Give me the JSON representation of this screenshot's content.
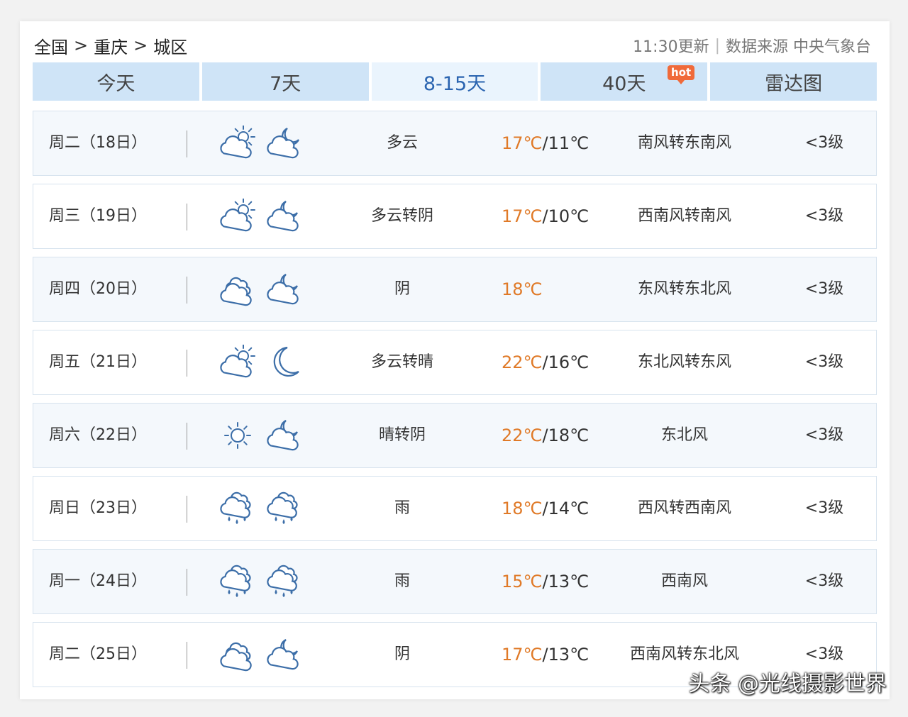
{
  "breadcrumb": {
    "country": "全国",
    "city": "重庆",
    "district": "城区",
    "separator": ">"
  },
  "meta": {
    "update_time": "11:30更新",
    "source": "数据来源 中央气象台"
  },
  "tabs": [
    {
      "label": "今天"
    },
    {
      "label": "7天"
    },
    {
      "label": "8-15天",
      "active": true
    },
    {
      "label": "40天",
      "badge": "hot"
    },
    {
      "label": "雷达图"
    }
  ],
  "forecast": [
    {
      "day": "周二（18日）",
      "icon_day": "partly-cloudy-day-icon",
      "icon_night": "partly-cloudy-night-icon",
      "desc": "多云",
      "high": "17℃",
      "low": "/11℃",
      "wind": "南风转东南风",
      "level": "<3级"
    },
    {
      "day": "周三（19日）",
      "icon_day": "partly-cloudy-day-icon",
      "icon_night": "overcast-night-icon",
      "desc": "多云转阴",
      "high": "17℃",
      "low": "/10℃",
      "wind": "西南风转南风",
      "level": "<3级"
    },
    {
      "day": "周四（20日）",
      "icon_day": "overcast-icon",
      "icon_night": "overcast-night-icon",
      "desc": "阴",
      "high": "18℃",
      "low": "",
      "wind": "东风转东北风",
      "level": "<3级"
    },
    {
      "day": "周五（21日）",
      "icon_day": "partly-cloudy-day-icon",
      "icon_night": "moon-icon",
      "desc": "多云转晴",
      "high": "22℃",
      "low": "/16℃",
      "wind": "东北风转东风",
      "level": "<3级"
    },
    {
      "day": "周六（22日）",
      "icon_day": "sun-icon",
      "icon_night": "overcast-night-icon",
      "desc": "晴转阴",
      "high": "22℃",
      "low": "/18℃",
      "wind": "东北风",
      "level": "<3级"
    },
    {
      "day": "周日（23日）",
      "icon_day": "rain-icon",
      "icon_night": "rain-icon",
      "desc": "雨",
      "high": "18℃",
      "low": "/14℃",
      "wind": "西风转西南风",
      "level": "<3级"
    },
    {
      "day": "周一（24日）",
      "icon_day": "rain-icon",
      "icon_night": "rain-icon",
      "desc": "雨",
      "high": "15℃",
      "low": "/13℃",
      "wind": "西南风",
      "level": "<3级"
    },
    {
      "day": "周二（25日）",
      "icon_day": "overcast-icon",
      "icon_night": "overcast-night-icon",
      "desc": "阴",
      "high": "17℃",
      "low": "/13℃",
      "wind": "西南风转东北风",
      "level": "<3级"
    }
  ],
  "watermark": "头条 @光线摄影世界",
  "colors": {
    "tab_bg": "#cfe4f7",
    "tab_active_text": "#2a64b0",
    "high_temp": "#e07a28",
    "hot_badge": "#f06a3a"
  }
}
